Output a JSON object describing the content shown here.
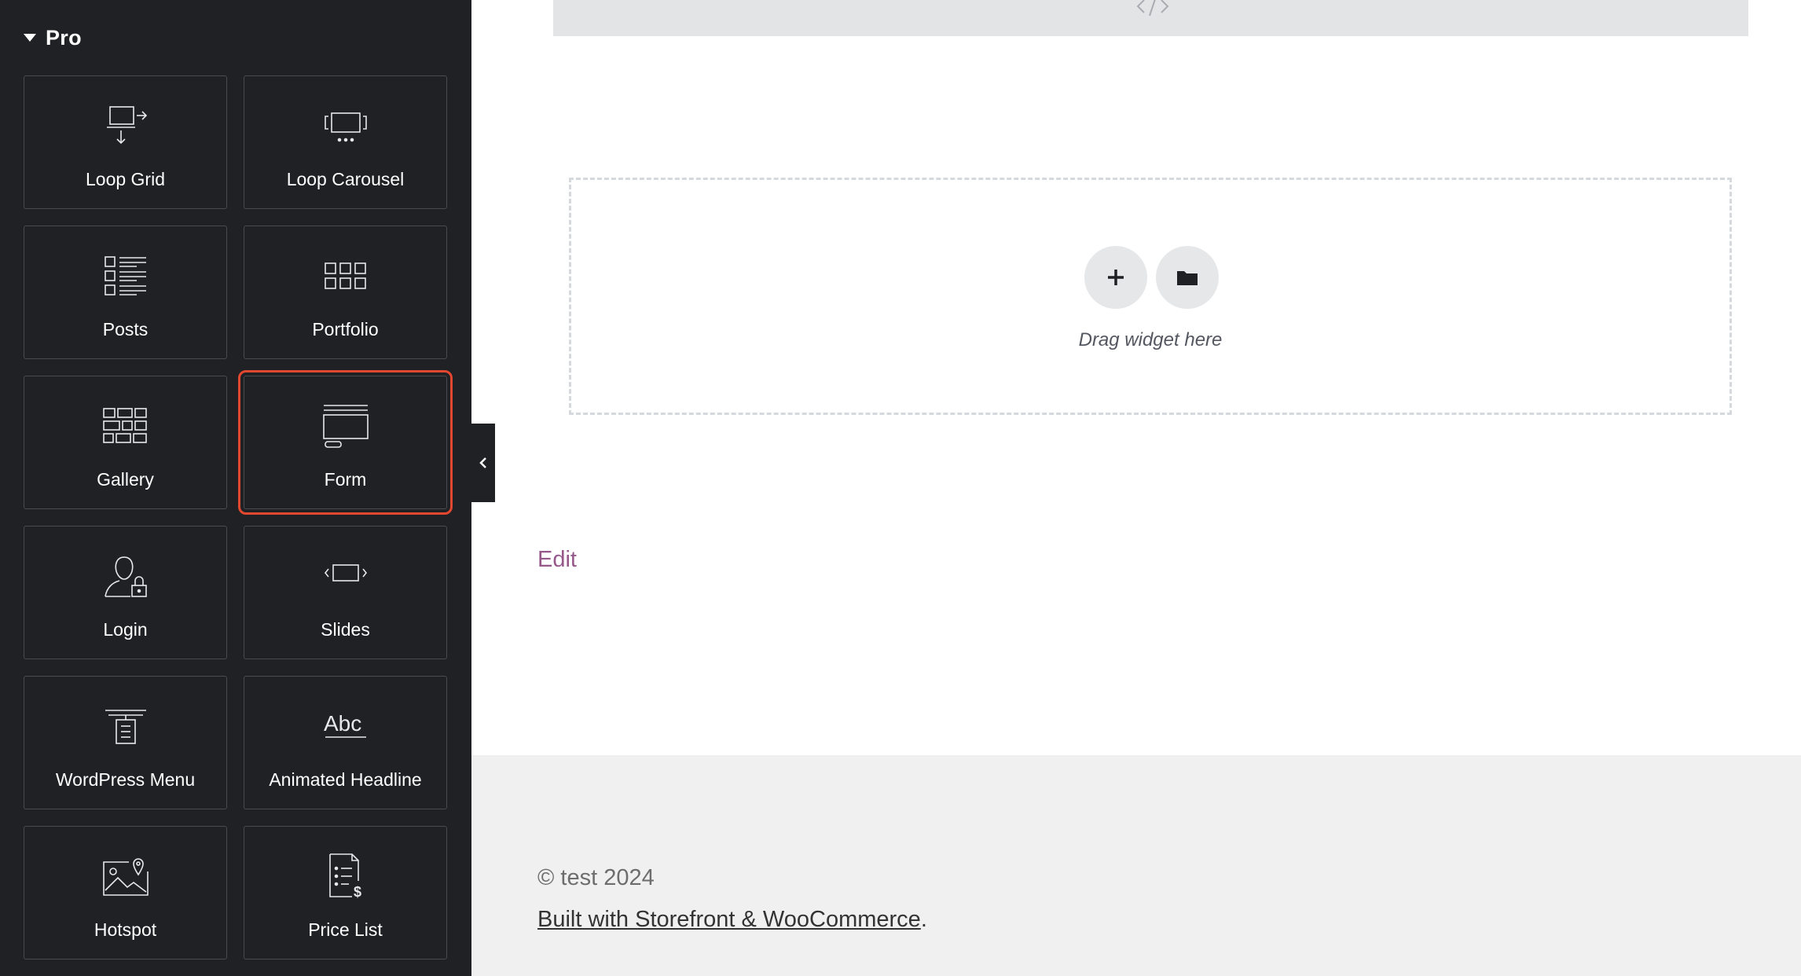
{
  "panel": {
    "section_title": "Pro",
    "widgets": [
      {
        "label": "Loop Grid",
        "icon": "loop-grid-icon"
      },
      {
        "label": "Loop Carousel",
        "icon": "loop-carousel-icon"
      },
      {
        "label": "Posts",
        "icon": "posts-icon"
      },
      {
        "label": "Portfolio",
        "icon": "portfolio-icon"
      },
      {
        "label": "Gallery",
        "icon": "gallery-icon"
      },
      {
        "label": "Form",
        "icon": "form-icon",
        "selected": true
      },
      {
        "label": "Login",
        "icon": "login-icon"
      },
      {
        "label": "Slides",
        "icon": "slides-icon"
      },
      {
        "label": "WordPress Menu",
        "icon": "wordpress-menu-icon"
      },
      {
        "label": "Animated Headline",
        "icon": "animated-headline-icon"
      },
      {
        "label": "Hotspot",
        "icon": "hotspot-icon"
      },
      {
        "label": "Price List",
        "icon": "price-list-icon"
      }
    ]
  },
  "canvas": {
    "dropzone_text": "Drag widget here",
    "edit_link": "Edit"
  },
  "footer": {
    "copyright": "© test 2024",
    "built_link": "Built with Storefront & WooCommerce",
    "built_suffix": "."
  },
  "colors": {
    "panel_bg": "#1f2124",
    "selection": "#e2472f",
    "edit_link": "#96588a",
    "footer_bg": "#f0f0f0"
  }
}
